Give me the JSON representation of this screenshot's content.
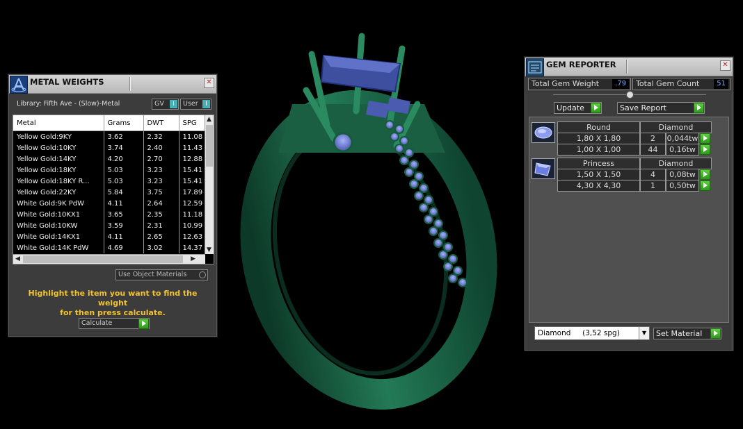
{
  "metal_weights": {
    "title": "METAL WEIGHTS",
    "library": "Library: Fifth Ave - (Slow)-Metal",
    "gv_label": "GV",
    "user_label": "User",
    "toggle_mark": "I",
    "columns": [
      "Metal",
      "Grams",
      "DWT",
      "SPG"
    ],
    "rows": [
      [
        "Yellow Gold:9KY",
        "3.62",
        "2.32",
        "11.08"
      ],
      [
        "Yellow Gold:10KY",
        "3.74",
        "2.40",
        "11.43"
      ],
      [
        "Yellow Gold:14KY",
        "4.20",
        "2.70",
        "12.88"
      ],
      [
        "Yellow Gold:18KY",
        "5.03",
        "3.23",
        "15.41"
      ],
      [
        "Yellow Gold:18KY R...",
        "5.03",
        "3.23",
        "15.41"
      ],
      [
        "Yellow Gold:22KY",
        "5.84",
        "3.75",
        "17.89"
      ],
      [
        "White Gold:9K PdW",
        "4.11",
        "2.64",
        "12.59"
      ],
      [
        "White Gold:10KX1",
        "3.65",
        "2.35",
        "11.18"
      ],
      [
        "White Gold:10KW",
        "3.59",
        "2.31",
        "10.99"
      ],
      [
        "White Gold:14KX1",
        "4.11",
        "2.65",
        "12.63"
      ],
      [
        "White Gold:14K PdW",
        "4.69",
        "3.02",
        "14.37"
      ]
    ],
    "use_object_materials": "Use Object Materials",
    "hint_line1": "Highlight the item you want to find the weight",
    "hint_line2": "for then press calculate.",
    "calculate_label": "Calculate"
  },
  "gem_reporter": {
    "title": "GEM REPORTER",
    "total_gem_weight_label": "Total Gem Weight",
    "total_gem_weight_value": ".79",
    "total_gem_count_label": "Total Gem Count",
    "total_gem_count_value": "51",
    "update_label": "Update",
    "save_report_label": "Save Report",
    "groups": [
      {
        "shape": "Round",
        "material": "Diamond",
        "icon": "round-gem-icon",
        "rows": [
          {
            "size": "1,80 X 1,80",
            "count": "2",
            "weight": "0,044tw"
          },
          {
            "size": "1,00 X 1,00",
            "count": "44",
            "weight": "0,16tw"
          }
        ]
      },
      {
        "shape": "Princess",
        "material": "Diamond",
        "icon": "princess-gem-icon",
        "rows": [
          {
            "size": "1,50 X 1,50",
            "count": "4",
            "weight": "0,08tw"
          },
          {
            "size": "4,30 X 4,30",
            "count": "1",
            "weight": "0,50tw"
          }
        ]
      }
    ],
    "material_select": "Diamond     (3,52 spg)",
    "set_material_label": "Set Material"
  },
  "colors": {
    "ring_metal": "#1f6b4c",
    "gem_blue": "#3a4e96",
    "hint_yellow": "#f1c232",
    "accent_green": "#3fb02a"
  }
}
